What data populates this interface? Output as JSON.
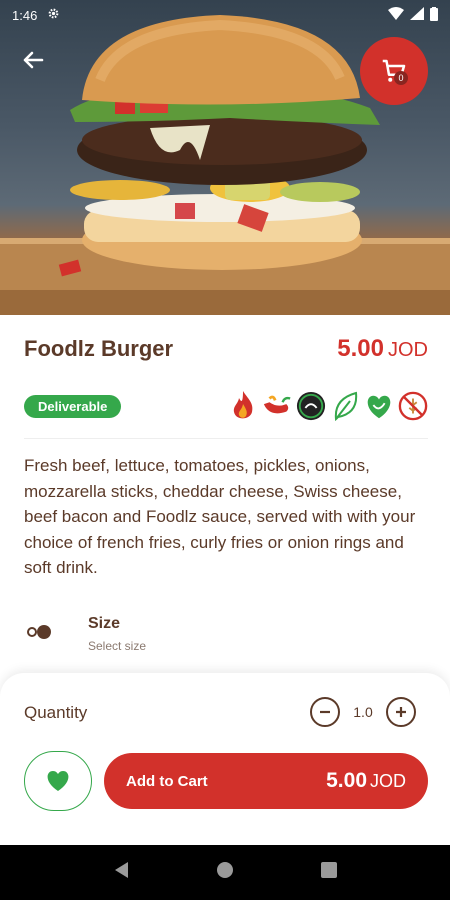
{
  "status": {
    "time": "1:46"
  },
  "product": {
    "name": "Foodlz Burger",
    "price": "5.00",
    "currency": "JOD",
    "badge": "Deliverable",
    "description": "Fresh beef, lettuce, tomatoes, pickles, onions, mozzarella sticks, cheddar cheese, Swiss cheese, beef bacon and Foodlz sauce, served with with your choice of french fries, curly fries or onion rings and soft drink.",
    "attribute_icons": [
      "flame-icon",
      "chili-icon",
      "halal-icon",
      "leaf-icon",
      "vegan-icon",
      "gluten-free-icon"
    ]
  },
  "cart": {
    "count": "0"
  },
  "size": {
    "label": "Size",
    "hint": "Select size"
  },
  "order": {
    "quantity_label": "Quantity",
    "quantity_value": "1.0",
    "add_to_cart_label": "Add to Cart",
    "total": "5.00",
    "currency": "JOD"
  },
  "colors": {
    "accent": "#d2312b",
    "brand_text": "#5b3a29",
    "green": "#35a84b"
  }
}
